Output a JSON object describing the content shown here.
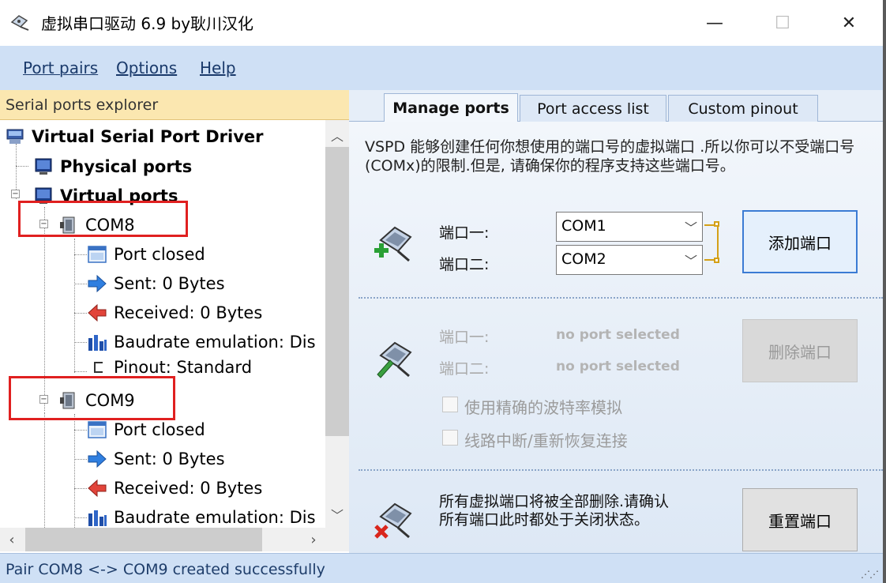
{
  "window": {
    "title": "虚拟串口驱动 6.9 by耿川汉化",
    "minimize_glyph": "—",
    "maximize_glyph": "☐",
    "close_glyph": "✕"
  },
  "menu": [
    {
      "label": "Port pairs"
    },
    {
      "label": "Options"
    },
    {
      "label": "Help"
    }
  ],
  "explorer": {
    "header": "Serial ports explorer",
    "root": "Virtual Serial Port Driver",
    "physical": "Physical ports",
    "virtual": "Virtual ports",
    "ports": [
      {
        "name": "COM8",
        "children": [
          "Port closed",
          "Sent: 0 Bytes",
          "Received: 0 Bytes",
          "Baudrate emulation: Dis",
          "Pinout: Standard"
        ]
      },
      {
        "name": "COM9",
        "children": [
          "Port closed",
          "Sent: 0 Bytes",
          "Received: 0 Bytes",
          "Baudrate emulation: Dis"
        ]
      }
    ]
  },
  "tabs": [
    {
      "label": "Manage ports",
      "active": true
    },
    {
      "label": "Port access list",
      "active": false
    },
    {
      "label": "Custom pinout",
      "active": false
    }
  ],
  "manage": {
    "description": "VSPD 能够创建任何你想使用的端口号的虚拟端口 .所以你可以不受端口号(COMx)的限制.但是, 请确保你的程序支持这些端口号。",
    "add": {
      "port1_label": "端口一:",
      "port2_label": "端口二:",
      "port1_value": "COM1",
      "port2_value": "COM2",
      "button": "添加端口"
    },
    "delete": {
      "port1_label": "端口一:",
      "port2_label": "端口二:",
      "port1_value": "no port selected",
      "port2_value": "no port selected",
      "button": "删除端口",
      "option1": "使用精确的波特率模拟",
      "option2": "线路中断/重新恢复连接"
    },
    "reset": {
      "text": "所有虚拟端口将被全部删除.请确认所有端口此时都处于关闭状态。",
      "button": "重置端口"
    }
  },
  "status": "Pair COM8 <-> COM9 created successfully"
}
